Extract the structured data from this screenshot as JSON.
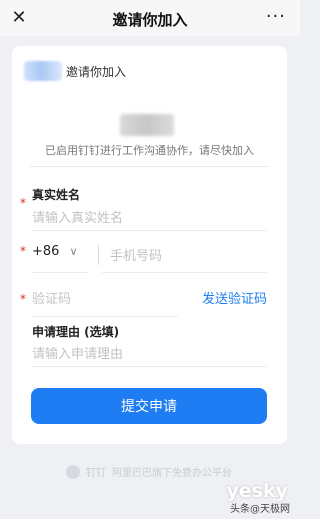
{
  "header": {
    "close_icon": "close-icon",
    "title": "邀请你加入",
    "more_icon": "more-icon"
  },
  "card": {
    "org_invite_text": "邀请你加入",
    "subtitle": "已启用钉钉进行工作沟通协作，请尽快加入",
    "fields": {
      "name_label": "真实姓名",
      "name_placeholder": "请输入真实姓名",
      "country_code": "+86",
      "phone_placeholder": "手机号码",
      "code_placeholder": "验证码",
      "send_code_label": "发送验证码",
      "reason_label": "申请理由 (选填)",
      "reason_placeholder": "请输入申请理由"
    },
    "required_mark": "*",
    "submit_label": "提交申请"
  },
  "footer": {
    "brand": "钉钉",
    "tagline": "阿里巴巴旗下免费办公平台"
  },
  "watermarks": {
    "yesky": "yesky",
    "site": "头条@天极网"
  },
  "colors": {
    "accent": "#1e7df2",
    "required": "#e0301e",
    "placeholder": "#c2c2c2"
  }
}
